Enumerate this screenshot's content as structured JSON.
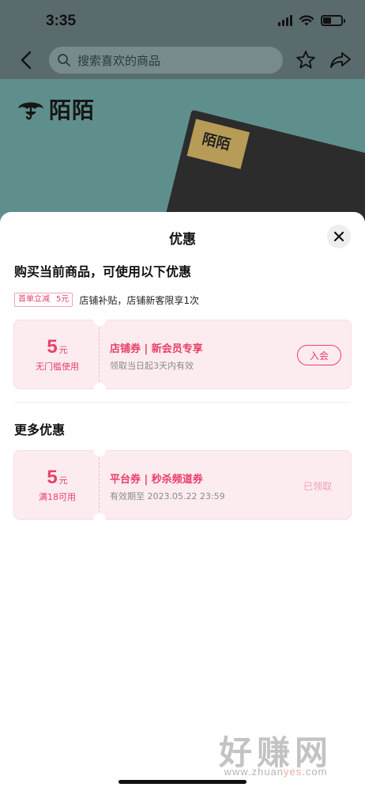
{
  "status_bar": {
    "time": "3:35"
  },
  "nav": {
    "search_placeholder": "搜索喜欢的商品"
  },
  "product": {
    "brand": "陌陌",
    "box_label": "陌陌"
  },
  "sheet": {
    "title": "优惠",
    "section_current": "购买当前商品，可使用以下优惠",
    "promo": {
      "tag_label": "首单立减",
      "tag_value": "5元",
      "text": "店铺补贴，店铺新客限享1次"
    },
    "coupons": [
      {
        "amount": "5",
        "unit": "元",
        "condition": "无门槛使用",
        "title": "店铺券 | 新会员专享",
        "subtitle": "领取当日起3天内有效",
        "action": "入会"
      },
      {
        "amount": "5",
        "unit": "元",
        "condition": "满18可用",
        "title": "平台券 | 秒杀频道券",
        "subtitle": "有效期至 2023.05.22 23:59",
        "status": "已领取"
      }
    ],
    "section_more": "更多优惠"
  },
  "watermark": {
    "text": "好赚网",
    "url_prefix": "www.zhuan",
    "url_highlight": "yes",
    "url_suffix": ".com"
  },
  "colors": {
    "accent": "#e8406a",
    "coupon_bg": "#fdecef",
    "backdrop": "#5f8f8d"
  },
  "icons": [
    "back-icon",
    "search-icon",
    "star-icon",
    "share-icon",
    "close-icon",
    "umbrella-logo-icon",
    "wifi-icon",
    "signal-icon",
    "battery-icon"
  ]
}
